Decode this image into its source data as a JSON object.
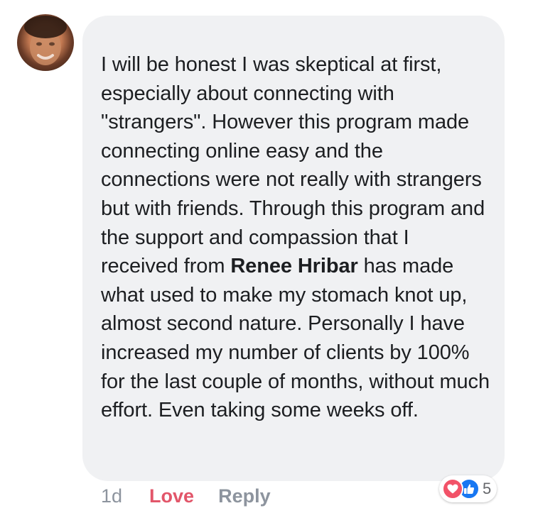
{
  "comment": {
    "text_before_mention": "I will be honest I was skeptical at first, especially about connecting with \"strangers\".  However this program made connecting online easy and the connections were not really with strangers but with friends.  Through this program and the support and compassion that I received from ",
    "mention": "Renee Hribar",
    "text_after_mention": " has made what used to make my stomach knot up, almost second nature.  Personally I have increased my number of clients by 100% for the last couple of months, without much effort.  Even taking some weeks off."
  },
  "actions": {
    "timestamp": "1d",
    "love_label": "Love",
    "reply_label": "Reply"
  },
  "reactions": {
    "icons": [
      "love-icon",
      "like-icon"
    ],
    "count": "5"
  },
  "colors": {
    "bubble": "#f0f1f3",
    "text": "#1c1e21",
    "love": "#e2566a",
    "meta": "#8d949e",
    "like": "#1877f2"
  }
}
